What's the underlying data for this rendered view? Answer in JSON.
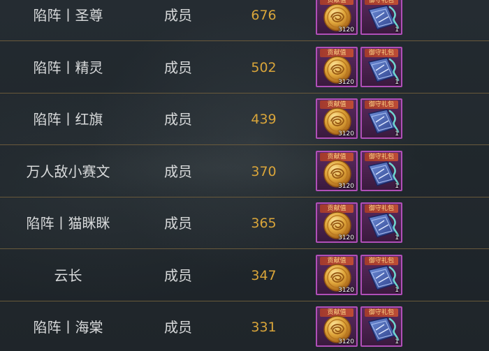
{
  "rows": [
    {
      "name": "陷阵丨圣尊",
      "role": "成员",
      "points": "676",
      "reward_coin_label": "贡献值",
      "reward_coin_count": "3120",
      "reward_book_label": "御守礼包",
      "reward_book_count": "1"
    },
    {
      "name": "陷阵丨精灵",
      "role": "成员",
      "points": "502",
      "reward_coin_label": "贡献值",
      "reward_coin_count": "3120",
      "reward_book_label": "御守礼包",
      "reward_book_count": "1"
    },
    {
      "name": "陷阵丨红旗",
      "role": "成员",
      "points": "439",
      "reward_coin_label": "贡献值",
      "reward_coin_count": "3120",
      "reward_book_label": "御守礼包",
      "reward_book_count": "1"
    },
    {
      "name": "万人敌小赛文",
      "role": "成员",
      "points": "370",
      "reward_coin_label": "贡献值",
      "reward_coin_count": "3120",
      "reward_book_label": "御守礼包",
      "reward_book_count": "1"
    },
    {
      "name": "陷阵丨猫眯眯",
      "role": "成员",
      "points": "365",
      "reward_coin_label": "贡献值",
      "reward_coin_count": "3120",
      "reward_book_label": "御守礼包",
      "reward_book_count": "1"
    },
    {
      "name": "云长",
      "role": "成员",
      "points": "347",
      "reward_coin_label": "贡献值",
      "reward_coin_count": "3120",
      "reward_book_label": "御守礼包",
      "reward_book_count": "1"
    },
    {
      "name": "陷阵丨海棠",
      "role": "成员",
      "points": "331",
      "reward_coin_label": "贡献值",
      "reward_coin_count": "3120",
      "reward_book_label": "御守礼包",
      "reward_book_count": "1"
    }
  ],
  "icons": {
    "coin": "contribution-coin-icon",
    "book": "guard-gift-pack-icon"
  },
  "colors": {
    "points": "#d9a53a",
    "text": "#d8dadb",
    "divider": "#6a5a3c",
    "item_border": "#b04fb8",
    "background": "#20272c"
  }
}
